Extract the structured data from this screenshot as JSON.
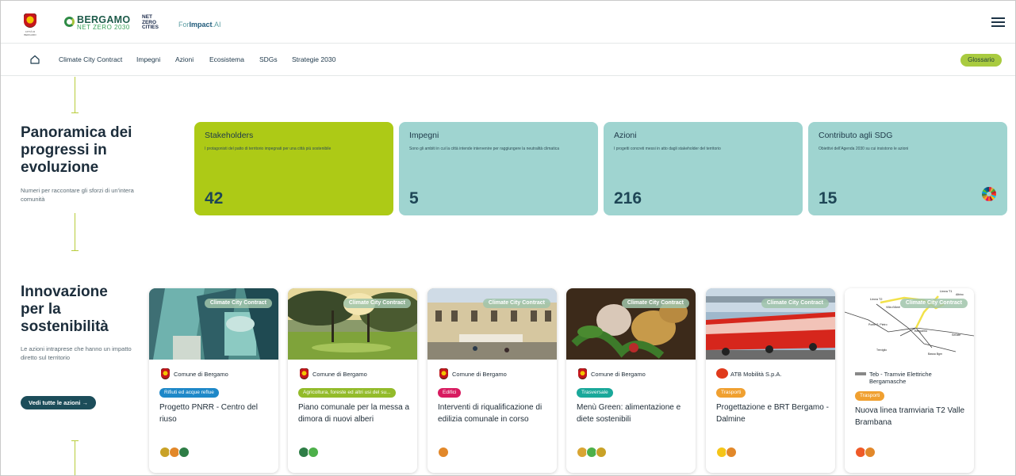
{
  "header": {
    "crest_caption": "CITTÀ DI BERGAMO",
    "brand_title": "BERGAMO",
    "brand_subtitle": "NET ZERO 2030",
    "nzc_line1": "NET",
    "nzc_line2": "ZERO",
    "nzc_line3": "CITIES",
    "forimpact_prefix": "For",
    "forimpact_bold": "Impact",
    "forimpact_suffix": ".AI"
  },
  "nav": {
    "items": [
      {
        "label": "Climate City Contract"
      },
      {
        "label": "Impegni"
      },
      {
        "label": "Azioni"
      },
      {
        "label": "Ecosistema"
      },
      {
        "label": "SDGs"
      },
      {
        "label": "Strategie 2030"
      }
    ],
    "glossary_label": "Glossario"
  },
  "overview": {
    "title": "Panoramica dei progressi in evoluzione",
    "subtitle": "Numeri per raccontare gli sforzi di un'intera comunità",
    "stats": [
      {
        "title": "Stakeholders",
        "desc": "I protagonisti del patto di territorio impegnati per una città più sostenibile",
        "value": "42"
      },
      {
        "title": "Impegni",
        "desc": "Sono gli ambiti in cui la città intende intervenire per raggiungere la neutralità climatica",
        "value": "5"
      },
      {
        "title": "Azioni",
        "desc": "I progetti concreti messi in atto dagli stakeholder del territorio",
        "value": "216"
      },
      {
        "title": "Contributo agli SDG",
        "desc": "Obiettivi dell'Agenda 2030 su cui insistono le azioni",
        "value": "15"
      }
    ]
  },
  "innovation": {
    "title": "Innovazione per la sostenibilità",
    "subtitle": "Le azioni intraprese che hanno un impatto diretto sul territorio",
    "cta_label": "Vedi tutte le azioni →",
    "cards": [
      {
        "tag": "Climate City Contract",
        "org": "Comune di Bergamo",
        "category": "Rifiuti ed acque reflue",
        "category_color": "#1e88c8",
        "title": "Progetto PNRR - Centro del riuso",
        "icons": [
          "#c9a227",
          "#e2882a",
          "#2e7d46"
        ]
      },
      {
        "tag": "Climate City Contract",
        "org": "Comune di Bergamo",
        "category": "Agricoltura, foreste ed altri usi del su...",
        "category_color": "#93bb2a",
        "title": "Piano comunale per la messa a dimora di nuovi alberi",
        "icons": [
          "#2e7d46",
          "#4db04a"
        ]
      },
      {
        "tag": "Climate City Contract",
        "org": "Comune di Bergamo",
        "category": "Edifici",
        "category_color": "#d81b60",
        "title": "Interventi di riqualificazione di edilizia comunale in corso",
        "icons": [
          "#e2882a"
        ]
      },
      {
        "tag": "Climate City Contract",
        "org": "Comune di Bergamo",
        "category": "Trasversale",
        "category_color": "#1aa89a",
        "title": "Menù Green: alimentazione e diete sostenibili",
        "icons": [
          "#d9a533",
          "#4db04a",
          "#c9a227"
        ]
      },
      {
        "tag": "Climate City Contract",
        "org": "ATB Mobilità S.p.A.",
        "category": "Trasporti",
        "category_color": "#f0a030",
        "title": "Progettazione e BRT Bergamo - Dalmine",
        "icons": [
          "#f5c518",
          "#e2882a"
        ]
      },
      {
        "tag": "Climate City Contract",
        "org": "Teb - Tramvie Elettriche Bergamasche",
        "category": "Trasporti",
        "category_color": "#f0a030",
        "title": "Nuova linea tramviaria T2 Valle Brambana",
        "icons": [
          "#ef5a28",
          "#e2882a"
        ]
      }
    ]
  },
  "map_labels": [
    "Linea T2",
    "Linea T1",
    "Albino",
    "Ponte S. Pietro",
    "Bergamo",
    "Seriate",
    "Treviglio",
    "Bassa Bgm",
    "Villa d'Almè"
  ]
}
